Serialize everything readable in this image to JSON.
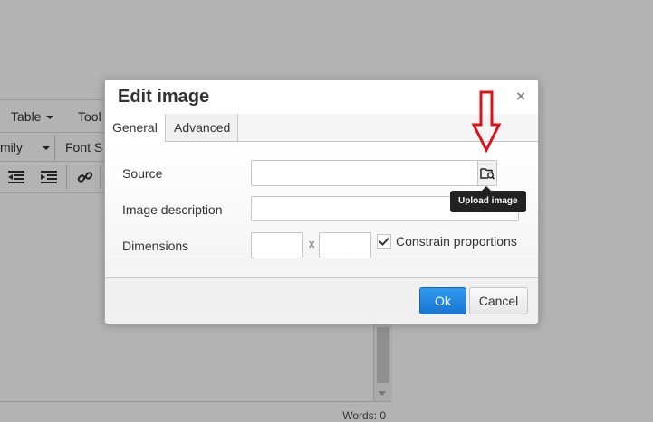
{
  "editor": {
    "menu": [
      {
        "label": "Table",
        "has_caret": true
      },
      {
        "label": "Tool",
        "has_caret": false
      }
    ],
    "toolbar1": [
      {
        "label": "mily",
        "has_caret": true
      },
      {
        "label": "Font S",
        "has_caret": false
      }
    ],
    "toolbar2_icons": [
      "outdent-icon",
      "indent-icon",
      "link-icon"
    ],
    "status": {
      "words": "Words: 0"
    }
  },
  "dialog": {
    "title": "Edit image",
    "close_label": "×",
    "tabs": [
      {
        "label": "General",
        "active": true
      },
      {
        "label": "Advanced",
        "active": false
      }
    ],
    "fields": {
      "source_label": "Source",
      "source_value": "",
      "description_label": "Image description",
      "description_value": "",
      "dimensions_label": "Dimensions",
      "width_value": "",
      "height_value": "",
      "x_separator": "x",
      "constrain_label": "Constrain proportions",
      "constrain_checked": true
    },
    "buttons": {
      "ok": "Ok",
      "cancel": "Cancel"
    },
    "tooltip": "Upload image"
  },
  "colors": {
    "backdrop": "#b3b3b3",
    "primary_button": "#2d8ad8",
    "annotation_arrow": "#e0101a"
  }
}
